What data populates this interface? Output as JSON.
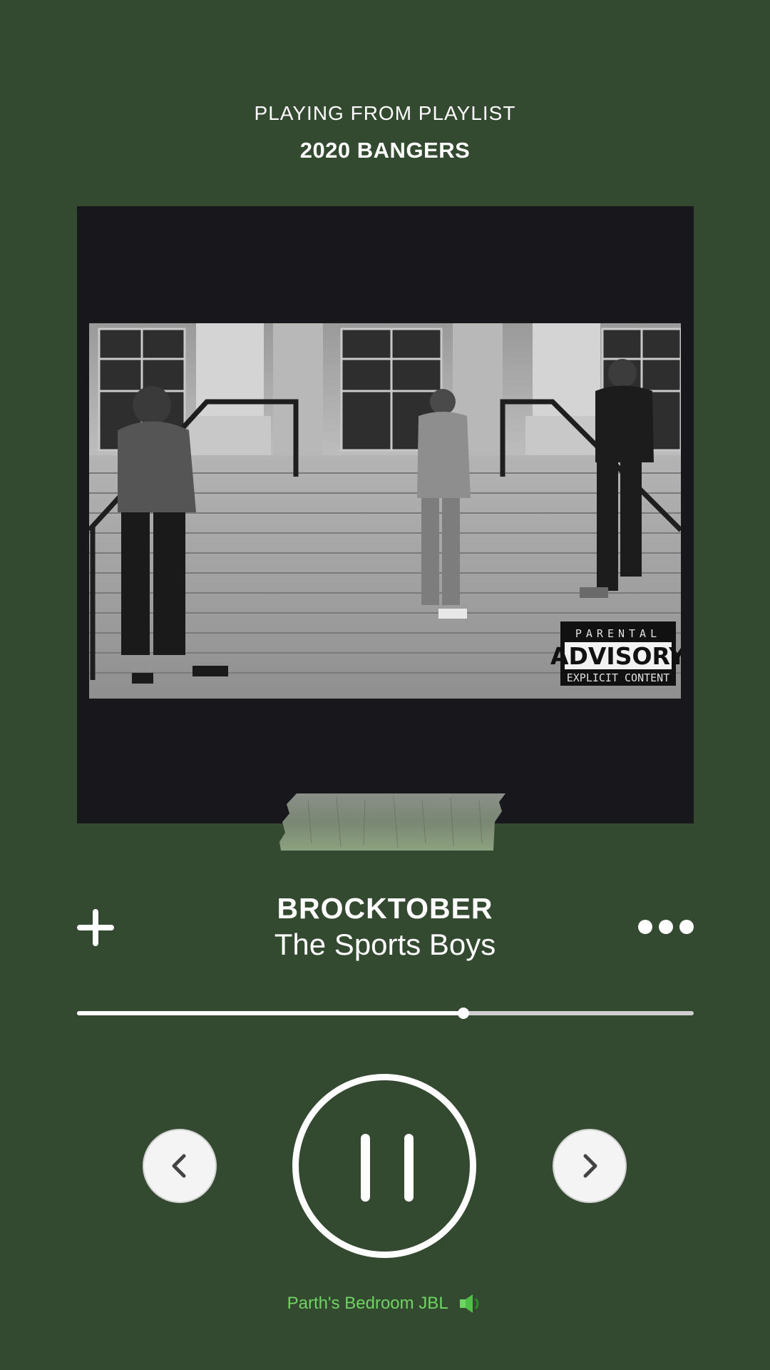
{
  "header": {
    "context_label": "PLAYING FROM PLAYLIST",
    "playlist_name": "2020 BANGERS"
  },
  "album_art": {
    "label_line1": "PARENTAL",
    "label_line2": "ADVISORY",
    "label_line3": "EXPLICIT CONTENT"
  },
  "track": {
    "title": "BROCKTOBER",
    "artist": "The Sports Boys"
  },
  "playback": {
    "progress": 0.627,
    "state": "playing"
  },
  "device": {
    "name": "Parth's Bedroom JBL",
    "icon": "speaker-icon"
  },
  "colors": {
    "background": "#344a30",
    "device_accent": "#6ed462"
  }
}
